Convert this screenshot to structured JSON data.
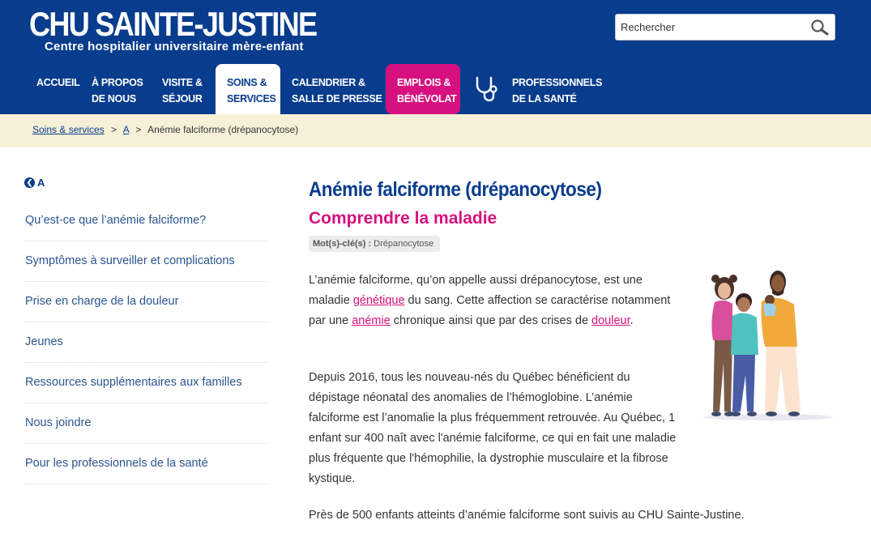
{
  "header": {
    "logo_title": "CHU SAINTE-JUSTINE",
    "logo_subtitle": "Centre hospitalier universitaire mère-enfant",
    "search_placeholder": "Rechercher",
    "nav": [
      {
        "label": "ACCUEIL"
      },
      {
        "label": "À PROPOS\nDE NOUS"
      },
      {
        "label": "VISITE &\nSÉJOUR"
      },
      {
        "label": "SOINS &\nSERVICES"
      },
      {
        "label": "CALENDRIER &\nSALLE DE PRESSE"
      },
      {
        "label": "EMPLOIS &\nBÉNÉVOLAT"
      },
      {
        "label": "PROFESSIONNELS\nDE LA SANTÉ"
      }
    ]
  },
  "breadcrumb": {
    "items": [
      "Soins & services",
      "A",
      "Anémie falciforme (drépanocytose)"
    ],
    "separator": ">"
  },
  "sidebar": {
    "back_label": "A",
    "items": [
      {
        "label": "Qu’est-ce que l’anémie falciforme?"
      },
      {
        "label": "Symptômes à surveiller et complications"
      },
      {
        "label": "Prise en charge de la douleur"
      },
      {
        "label": "Jeunes"
      },
      {
        "label": "Ressources supplémentaires aux familles"
      },
      {
        "label": "Nous joindre"
      },
      {
        "label": "Pour les professionnels de la santé"
      }
    ]
  },
  "main": {
    "title": "Anémie falciforme (drépanocytose)",
    "subtitle": "Comprendre la maladie",
    "keyword_label": "Mot(s)-clé(s) :",
    "keyword_value": "Drépanocytose",
    "p1": {
      "t1": "L’anémie falciforme, qu’on appelle aussi drépanocytose, est une maladie ",
      "link1": "génétique",
      "t2": " du sang. Cette affection se caractérise notamment par une ",
      "link2": "anémie",
      "t3": " chronique ainsi que par des crises de ",
      "link3": "douleur",
      "t4": "."
    },
    "p2": "Depuis 2016, tous les nouveau-nés du Québec bénéficient du dépistage néonatal des anomalies de l’hémoglobine. L’anémie falciforme est l’anomalie la plus fréquemment retrouvée. Au Québec, 1 enfant sur 400 naît avec l'anémie falciforme, ce qui en fait une maladie plus fréquente que l'hémophilie, la dystrophie musculaire et la fibrose kystique.",
    "p3": "Près de 500 enfants atteints d’anémie falciforme sont suivis au CHU Sainte-Justine."
  },
  "colors": {
    "brand_blue": "#083c8d",
    "accent_pink": "#d6117f",
    "breadcrumb_bg": "#f6f0d8"
  },
  "icons": [
    "search-icon",
    "stethoscope-icon",
    "back-arrow-icon",
    "family-illustration"
  ]
}
